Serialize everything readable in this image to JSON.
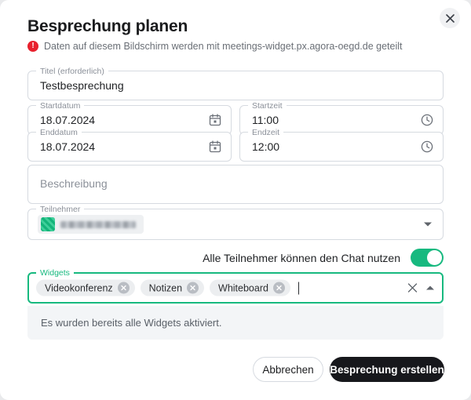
{
  "dialog": {
    "title": "Besprechung planen",
    "close_icon": "close-icon",
    "warning": {
      "icon": "error-exclamation-icon",
      "text": "Daten auf diesem Bildschirm werden mit meetings-widget.px.agora-oegd.de geteilt"
    }
  },
  "form": {
    "title_field": {
      "label": "Titel (erforderlich)",
      "value": "Testbesprechung"
    },
    "start_date": {
      "label": "Startdatum",
      "value": "18.07.2024",
      "icon": "calendar-icon"
    },
    "start_time": {
      "label": "Startzeit",
      "value": "11:00",
      "icon": "clock-icon"
    },
    "end_date": {
      "label": "Enddatum",
      "value": "18.07.2024",
      "icon": "calendar-icon"
    },
    "end_time": {
      "label": "Endzeit",
      "value": "12:00",
      "icon": "clock-icon"
    },
    "description": {
      "placeholder": "Beschreibung",
      "value": ""
    },
    "participants": {
      "label": "Teilnehmer",
      "chips": [
        {
          "name": "",
          "redacted": true
        }
      ],
      "dropdown_icon": "chevron-down-icon"
    },
    "chat_toggle": {
      "label": "Alle Teilnehmer können den Chat nutzen",
      "enabled": true
    },
    "widgets": {
      "label": "Widgets",
      "chips": [
        {
          "label": "Videokonferenz"
        },
        {
          "label": "Notizen"
        },
        {
          "label": "Whiteboard"
        }
      ],
      "clear_icon": "close-icon",
      "collapse_icon": "chevron-up-icon",
      "dropdown_message": "Es wurden bereits alle Widgets aktiviert."
    }
  },
  "footer": {
    "cancel_label": "Abbrechen",
    "submit_label": "Besprechung erstellen"
  },
  "colors": {
    "accent_green": "#17b97f",
    "error_red": "#e8212d",
    "submit_dark": "#17181c"
  }
}
